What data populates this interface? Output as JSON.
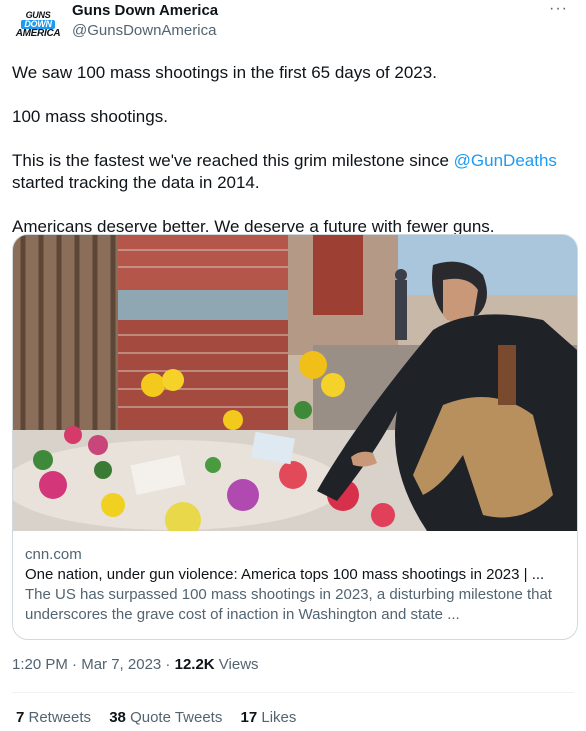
{
  "header": {
    "avatar_lines": [
      "GUNS",
      "DOWN",
      "AMERICA"
    ],
    "name": "Guns Down America",
    "handle": "@GunsDownAmerica",
    "more_label": "···"
  },
  "tweet": {
    "p1": "We saw 100 mass shootings in the first 65 days of 2023.",
    "p2": "100 mass shootings.",
    "p3_before": "This is the fastest we've reached this grim milestone since ",
    "p3_mention": "@GunDeaths",
    "p3_after": " started tracking the data in 2014.",
    "p4": "Americans deserve better. We deserve a future with fewer guns."
  },
  "card": {
    "domain": "cnn.com",
    "title": "One nation, under gun violence: America tops 100 mass shootings in 2023 | ...",
    "description": "The US has surpassed 100 mass shootings in 2023, a disturbing milestone that underscores the grave cost of inaction in Washington and state ..."
  },
  "meta": {
    "time": "1:20 PM",
    "sep1": " · ",
    "date": "Mar 7, 2023",
    "sep2": " · ",
    "views_count": "12.2K",
    "views_label": " Views"
  },
  "stats": {
    "retweets_count": "7",
    "retweets_label": " Retweets",
    "quotes_count": "38",
    "quotes_label": " Quote Tweets",
    "likes_count": "17",
    "likes_label": " Likes"
  },
  "colors": {
    "accent": "#1d9bf0",
    "text": "#0f1419",
    "secondary": "#536471",
    "border": "#cfd9de"
  }
}
